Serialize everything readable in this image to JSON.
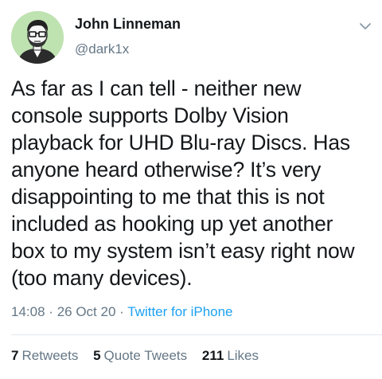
{
  "author": {
    "display_name": "John Linneman",
    "handle": "@dark1x"
  },
  "tweet": {
    "text": "As far as I can tell - neither new\nconsole supports Dolby Vision\nplayback for UHD Blu-ray Discs. Has\nanyone heard otherwise? It’s very\ndisappointing to me that this is not\nincluded as hooking up yet another\nbox to my system isn’t easy right now\n(too many devices).",
    "time": "14:08",
    "separator1": "·",
    "date": "26 Oct 20",
    "separator2": "·",
    "source": "Twitter for iPhone"
  },
  "stats": {
    "retweets_count": "7",
    "retweets_label": "Retweets",
    "quotes_count": "5",
    "quotes_label": "Quote Tweets",
    "likes_count": "211",
    "likes_label": "Likes"
  },
  "colors": {
    "text": "#14171a",
    "secondary": "#657786",
    "link": "#1da1f2",
    "divider": "#e1e8ed",
    "avatar_bg": "#bfe2b1"
  },
  "icons": {
    "menu": "chevron-down-icon",
    "avatar": "avatar"
  }
}
